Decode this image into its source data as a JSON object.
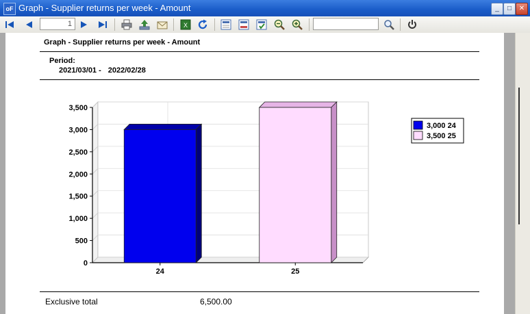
{
  "window": {
    "title": "Graph - Supplier returns per week - Amount",
    "icon_label": "oF"
  },
  "toolbar": {
    "page_value": "1",
    "search_value": ""
  },
  "report": {
    "title": "Graph - Supplier returns per week - Amount",
    "period_label": "Period:",
    "period_from": "2021/03/01 -",
    "period_to": "2022/02/28"
  },
  "chart_data": {
    "type": "bar",
    "categories": [
      "24",
      "25"
    ],
    "values": [
      3000,
      3500
    ],
    "ylim": [
      0,
      3500
    ],
    "yticks": [
      "0",
      "500",
      "1,000",
      "1,500",
      "2,000",
      "2,500",
      "3,000",
      "3,500"
    ],
    "colors": [
      "#0000ee",
      "#ffdcff"
    ],
    "legend": [
      "3,000 24",
      "3,500 25"
    ],
    "legend_position": "right",
    "grid": true
  },
  "footer": {
    "label": "Exclusive total",
    "value": "6,500.00"
  }
}
